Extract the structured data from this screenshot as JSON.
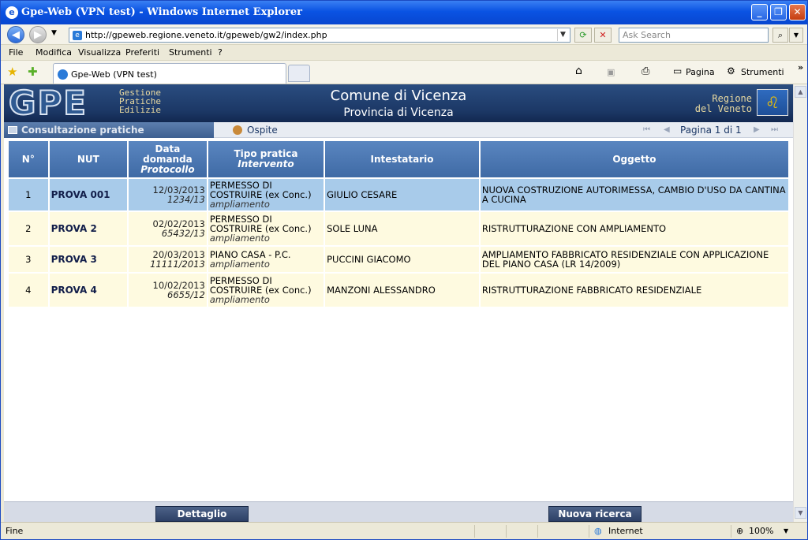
{
  "window": {
    "title": "Gpe-Web (VPN test) - Windows Internet Explorer",
    "minimize": "_",
    "maximize": "❐",
    "close": "✕"
  },
  "nav": {
    "url": "http://gpeweb.regione.veneto.it/gpeweb/gw2/index.php",
    "search_placeholder": "Ask Search"
  },
  "menu": [
    "File",
    "Modifica",
    "Visualizza",
    "Preferiti",
    "Strumenti",
    "?"
  ],
  "tab": {
    "title": "Gpe-Web (VPN test)"
  },
  "toolbar": {
    "pagina": "Pagina",
    "strumenti": "Strumenti",
    "more": "»"
  },
  "banner": {
    "logo": "GPE",
    "logo_sub": [
      "Gestione",
      "Pratiche",
      "Edilizie"
    ],
    "comune": "Comune di Vicenza",
    "provincia": "Provincia di Vicenza",
    "regione": [
      "Regione",
      "del Veneto"
    ]
  },
  "subbar": {
    "section": "Consultazione pratiche",
    "user": "Ospite",
    "page_label": "Pagina 1 di 1"
  },
  "table": {
    "headers": {
      "num": "N°",
      "nut": "NUT",
      "data1": "Data",
      "data2": "domanda",
      "data3": "Protocollo",
      "tipo1": "Tipo pratica",
      "tipo2": "Intervento",
      "intestatario": "Intestatario",
      "oggetto": "Oggetto"
    },
    "rows": [
      {
        "n": "1",
        "nut": "PROVA 001",
        "data": "12/03/2013",
        "prot": "1234/13",
        "tipo": "PERMESSO DI COSTRUIRE (ex Conc.)",
        "intervento": "ampliamento",
        "intestatario": "GIULIO CESARE",
        "oggetto": "NUOVA COSTRUZIONE AUTORIMESSA, CAMBIO D'USO DA CANTINA A CUCINA"
      },
      {
        "n": "2",
        "nut": "PROVA 2",
        "data": "02/02/2013",
        "prot": "65432/13",
        "tipo": "PERMESSO DI COSTRUIRE (ex Conc.)",
        "intervento": "ampliamento",
        "intestatario": "SOLE LUNA",
        "oggetto": "RISTRUTTURAZIONE CON AMPLIAMENTO"
      },
      {
        "n": "3",
        "nut": "PROVA 3",
        "data": "20/03/2013",
        "prot": "11111/2013",
        "tipo": "PIANO CASA - P.C.",
        "intervento": "ampliamento",
        "intestatario": "PUCCINI GIACOMO",
        "oggetto": "AMPLIAMENTO FABBRICATO RESIDENZIALE CON APPLICAZIONE DEL PIANO CASA (LR 14/2009)"
      },
      {
        "n": "4",
        "nut": "PROVA 4",
        "data": "10/02/2013",
        "prot": "6655/12",
        "tipo": "PERMESSO DI COSTRUIRE (ex Conc.)",
        "intervento": "ampliamento",
        "intestatario": "MANZONI ALESSANDRO",
        "oggetto": "RISTRUTTURAZIONE FABBRICATO RESIDENZIALE"
      }
    ]
  },
  "buttons": {
    "dettaglio": "Dettaglio",
    "nuova_ricerca": "Nuova ricerca"
  },
  "status": {
    "left": "Fine",
    "zone": "Internet",
    "zoom": "100%"
  }
}
